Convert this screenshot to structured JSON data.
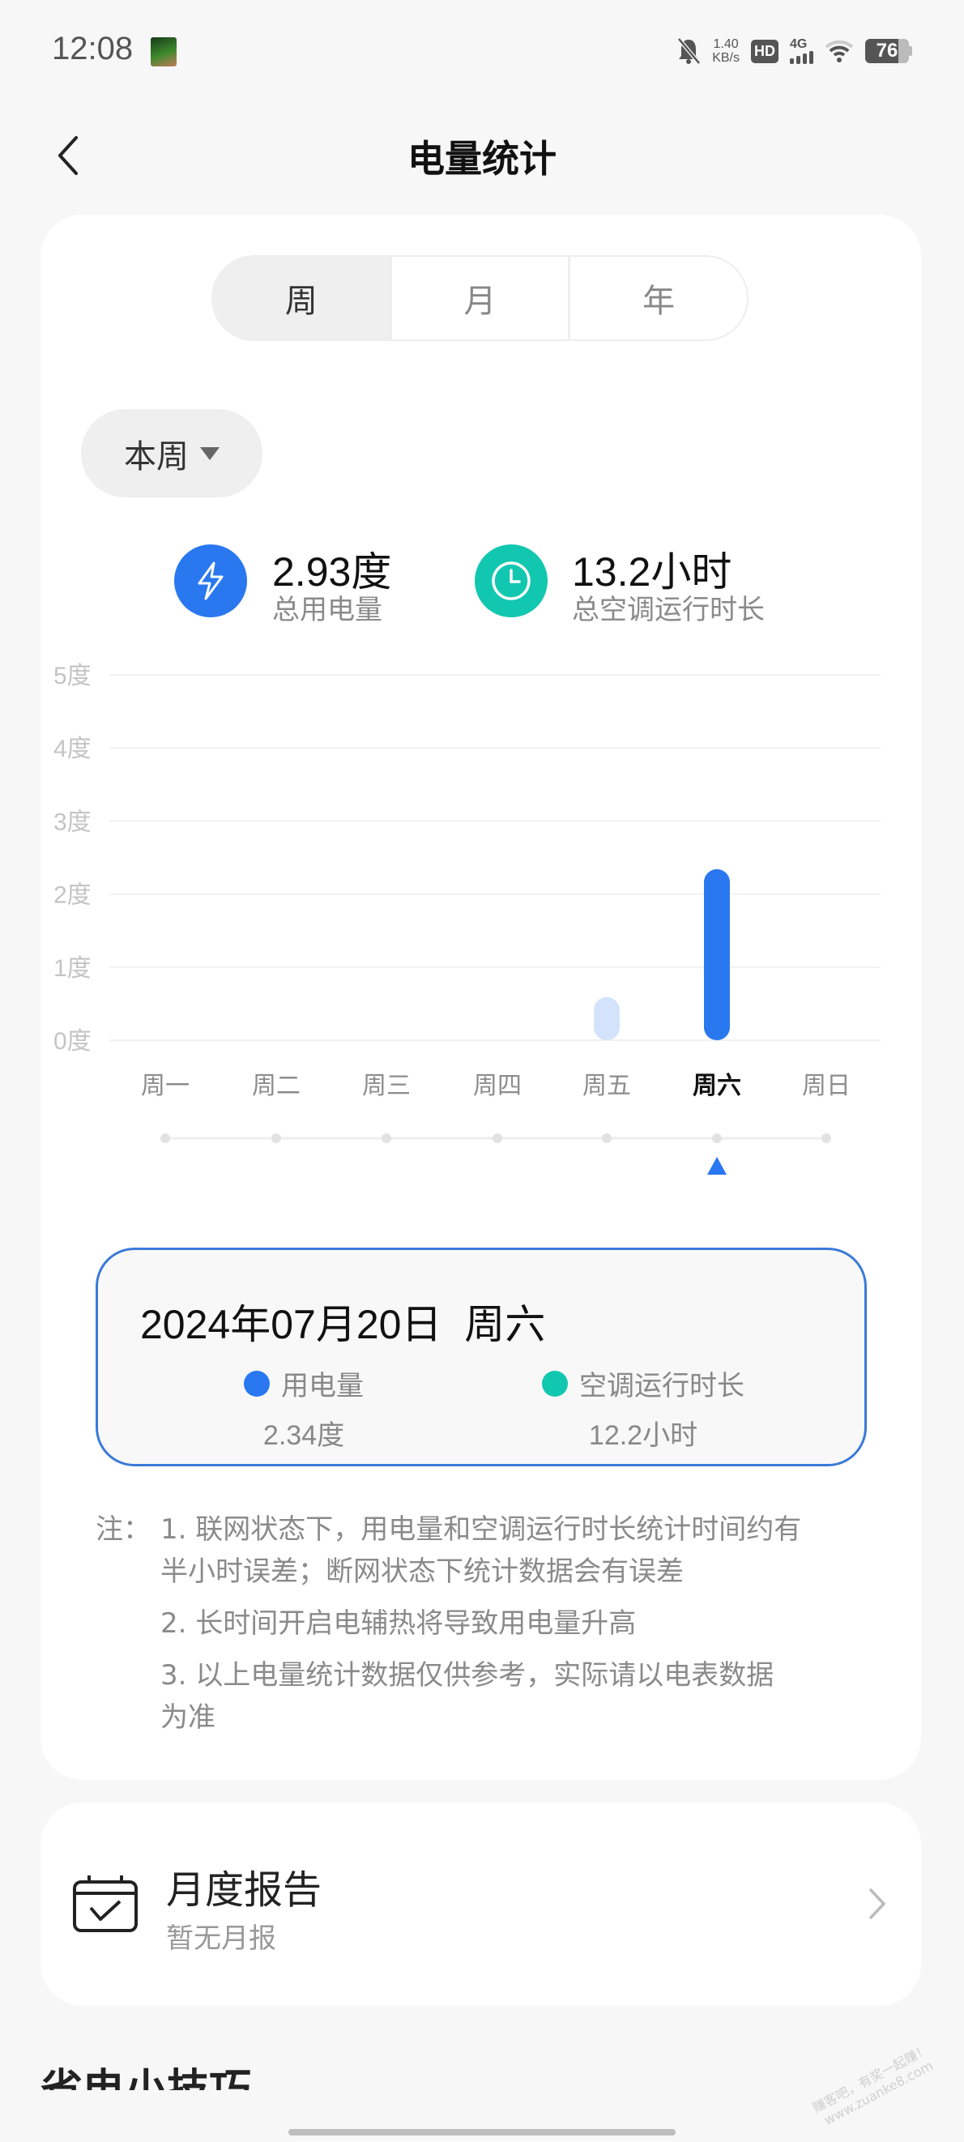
{
  "status_bar": {
    "time": "12:08",
    "net_speed_value": "1.40",
    "net_speed_unit": "KB/s",
    "hd_label": "HD",
    "network_label": "4G",
    "battery_level": "76",
    "icons": [
      "notification-app-icon",
      "mute-bell-icon",
      "hd-icon",
      "signal-4g-icon",
      "wifi-icon",
      "battery-icon"
    ]
  },
  "header": {
    "title": "电量统计",
    "back_icon": "chevron-left-icon"
  },
  "period_tabs": [
    {
      "label": "周",
      "active": true
    },
    {
      "label": "月",
      "active": false
    },
    {
      "label": "年",
      "active": false
    }
  ],
  "range_dropdown": {
    "selected": "本周"
  },
  "summary": {
    "energy": {
      "value": "2.93度",
      "label": "总用电量",
      "icon": "lightning-icon",
      "color": "#2a78f0"
    },
    "runtime": {
      "value": "13.2小时",
      "label": "总空调运行时长",
      "icon": "clock-icon",
      "color": "#12c7b0"
    }
  },
  "chart_data": {
    "type": "bar",
    "title": "",
    "xlabel": "",
    "ylabel": "",
    "unit": "度",
    "categories": [
      "周一",
      "周二",
      "周三",
      "周四",
      "周五",
      "周六",
      "周日"
    ],
    "values": [
      0,
      0,
      0,
      0,
      0.59,
      2.34,
      0
    ],
    "y_tick_labels": [
      "0度",
      "1度",
      "2度",
      "3度",
      "4度",
      "5度"
    ],
    "ylim": [
      0,
      5
    ],
    "grid": true,
    "selected_category": "周六",
    "colors": {
      "selected": "#2a78f0",
      "unselected": "#d3e3fb"
    }
  },
  "detail": {
    "date": "2024年07月20日  周六",
    "energy_label": "用电量",
    "energy_value": "2.34度",
    "energy_color": "#2a78f0",
    "runtime_label": "空调运行时长",
    "runtime_value": "12.2小时",
    "runtime_color": "#12c7b0"
  },
  "notes": {
    "prefix": "注：",
    "lines": [
      "1. 联网状态下，用电量和空调运行时长统计时间约有",
      "半小时误差；断网状态下统计数据会有误差",
      "2. 长时间开启电辅热将导致用电量升高",
      "3. 以上电量统计数据仅供参考，实际请以电表数据",
      "为准"
    ]
  },
  "monthly_report": {
    "title": "月度报告",
    "subtitle": "暂无月报",
    "icon": "calendar-check-icon"
  },
  "tips_heading": "省电小技巧",
  "watermark": [
    "赚客吧，有奖一起赚！",
    "www.zuanke8.com"
  ]
}
